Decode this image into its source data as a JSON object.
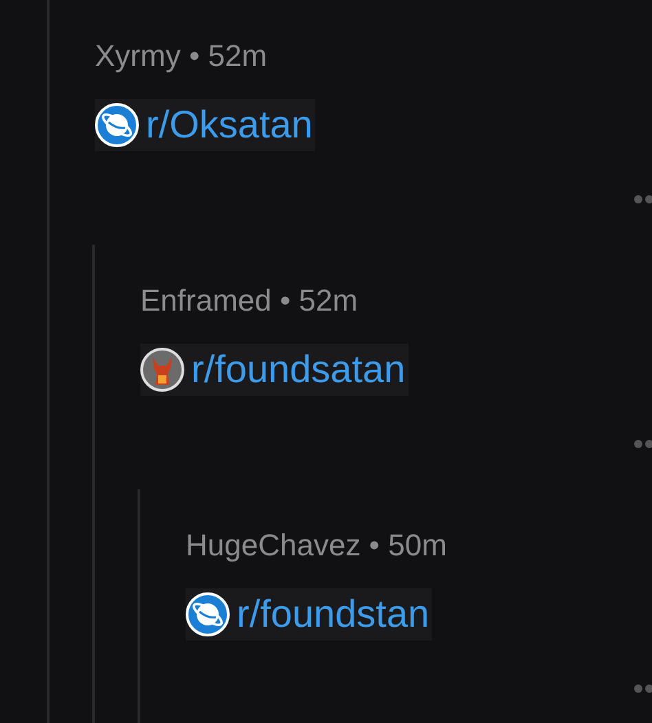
{
  "comments": [
    {
      "meta": "Xyrmy • 52m",
      "subreddit": "r/Oksatan",
      "kind": "planet",
      "children": [
        {
          "meta": "Enframed • 52m",
          "subreddit": "r/foundsatan",
          "kind": "custom",
          "children": [
            {
              "meta": "HugeChavez • 50m",
              "subreddit": "r/foundstan",
              "kind": "planet"
            }
          ]
        }
      ]
    }
  ]
}
